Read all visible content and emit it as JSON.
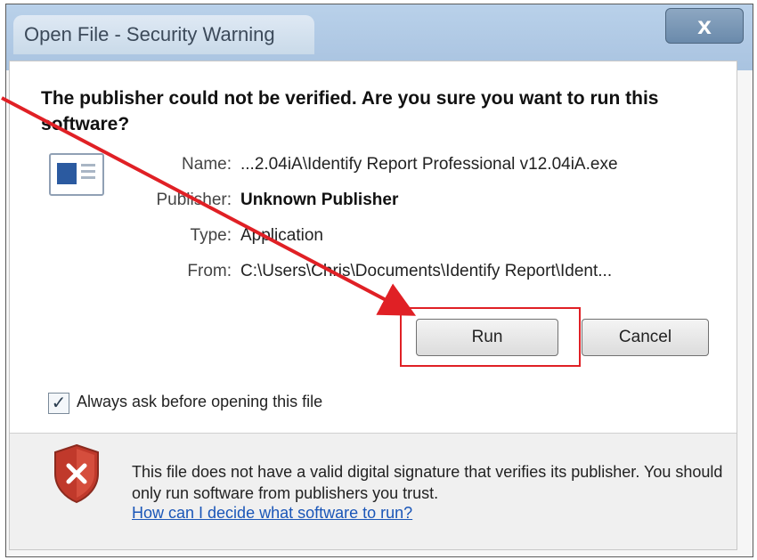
{
  "window": {
    "title": "Open File - Security Warning",
    "close_label": "x"
  },
  "main": {
    "headline": "The publisher could not be verified.  Are you sure you want to run this software?",
    "fields": [
      {
        "label": "Name:",
        "value": "...2.04iA\\Identify Report Professional v12.04iA.exe"
      },
      {
        "label": "Publisher:",
        "value": "Unknown Publisher"
      },
      {
        "label": "Type:",
        "value": "Application"
      },
      {
        "label": "From:",
        "value": "C:\\Users\\Chris\\Documents\\Identify Report\\Ident..."
      }
    ],
    "run_label": "Run",
    "cancel_label": "Cancel",
    "checkbox_label": "Always ask before opening this file",
    "checkbox_checked": true
  },
  "warning": {
    "text": "This file does not have a valid digital signature that verifies its publisher.  You should only run software from publishers you trust.",
    "link": "How can I decide what software to run?"
  },
  "colors": {
    "annotation": "#e02025",
    "link": "#1a56b8"
  },
  "icons": {
    "file": "application-file-icon",
    "shield": "shield-error-icon",
    "check": "checkmark"
  }
}
